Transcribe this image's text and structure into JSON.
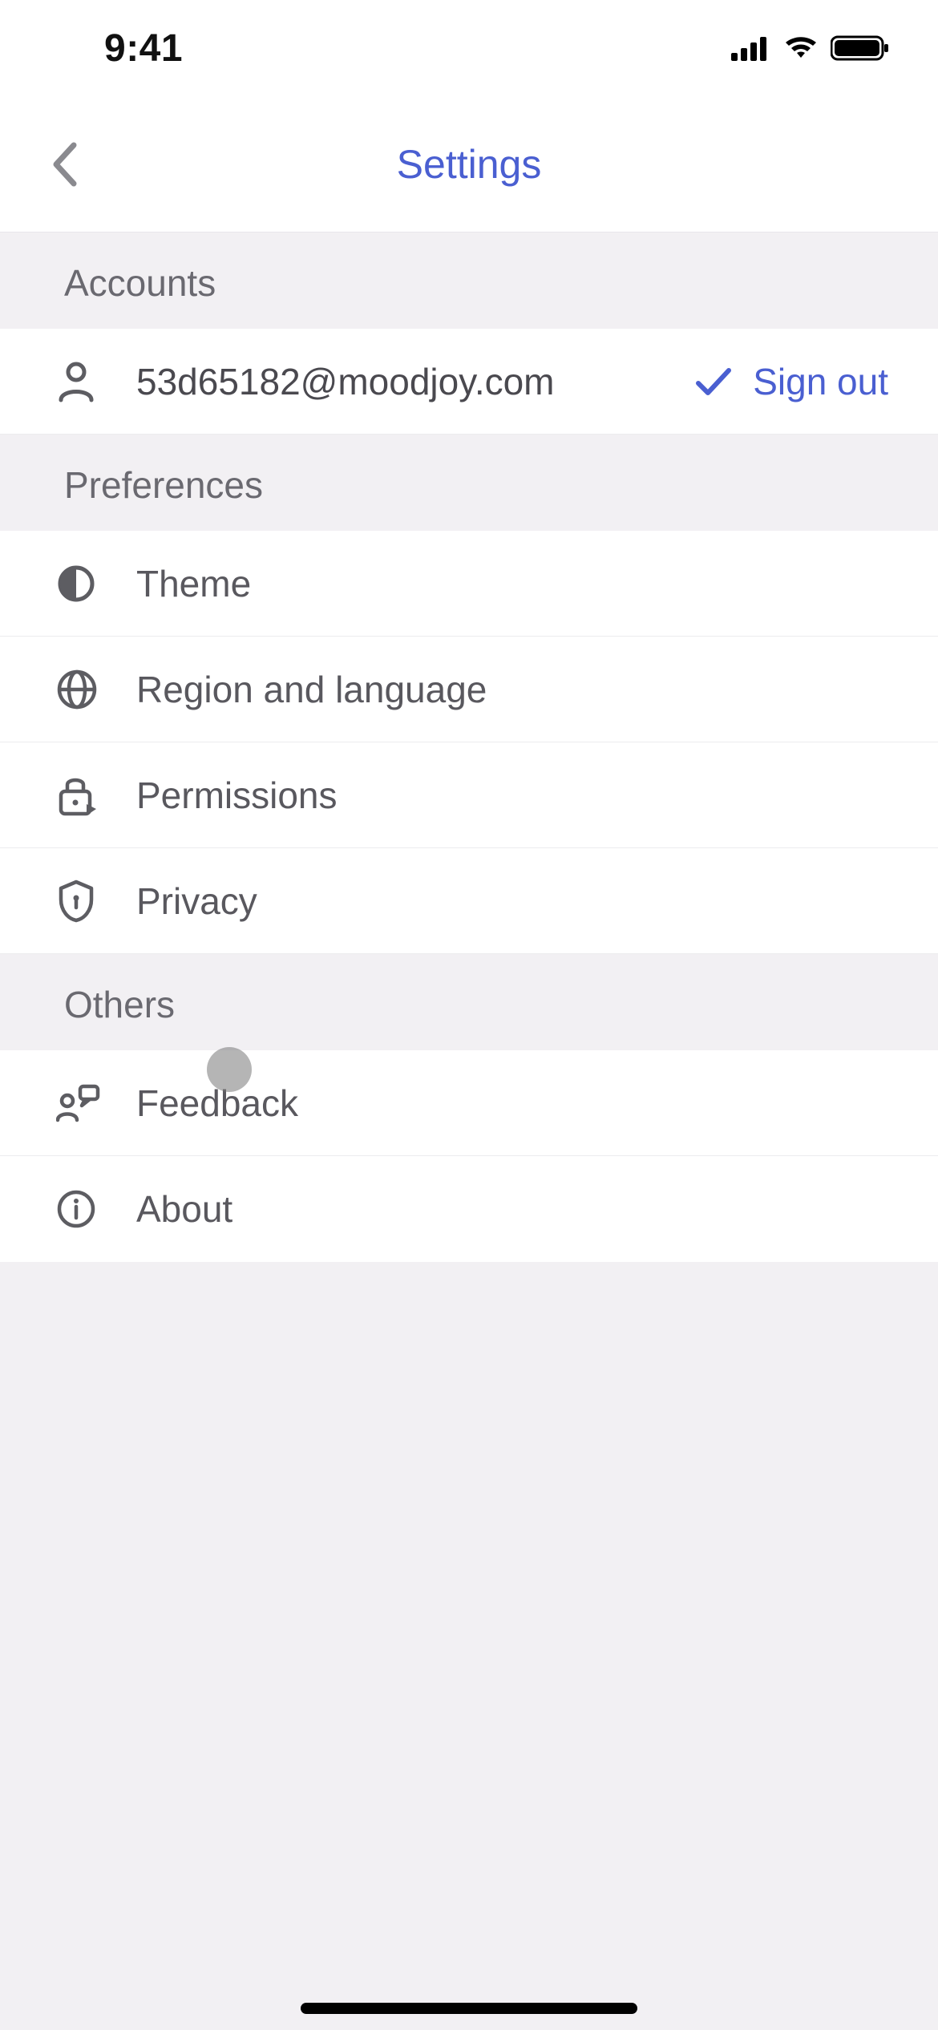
{
  "statusbar": {
    "time": "9:41"
  },
  "header": {
    "title": "Settings"
  },
  "sections": {
    "accounts": {
      "title": "Accounts",
      "email": "53d65182@moodjoy.com",
      "signout": "Sign out"
    },
    "preferences": {
      "title": "Preferences",
      "theme": "Theme",
      "region": "Region and language",
      "permissions": "Permissions",
      "privacy": "Privacy"
    },
    "others": {
      "title": "Others",
      "feedback": "Feedback",
      "about": "About"
    }
  },
  "colors": {
    "accent": "#4a5fd1",
    "bg": "#f2f0f3"
  }
}
